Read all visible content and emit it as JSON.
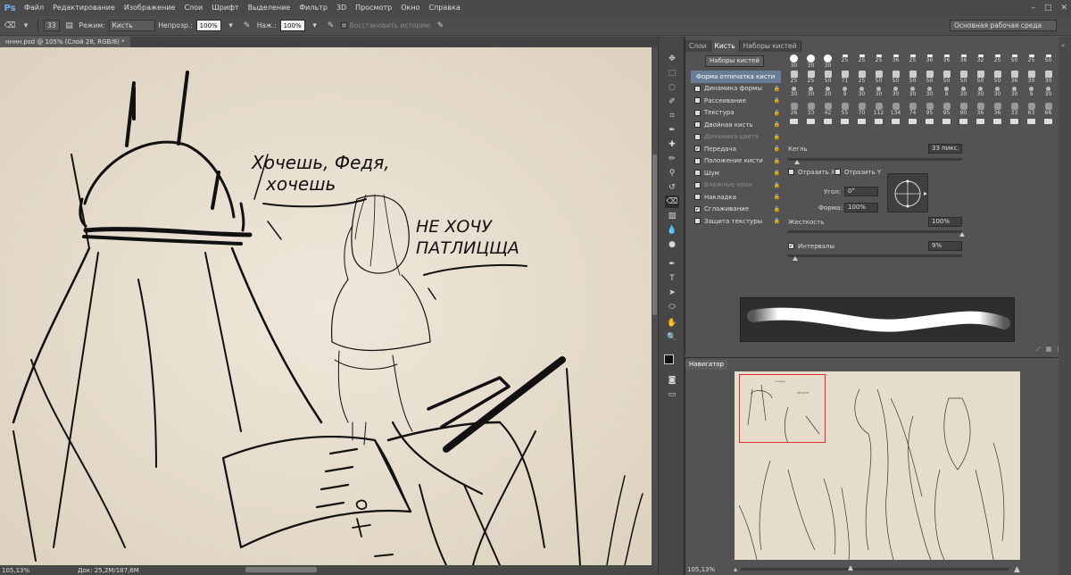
{
  "app": {
    "logo": "Ps"
  },
  "menu": [
    "Файл",
    "Редактирование",
    "Изображение",
    "Слои",
    "Шрифт",
    "Выделение",
    "Фильтр",
    "3D",
    "Просмотр",
    "Окно",
    "Справка"
  ],
  "options": {
    "brush_size": "33",
    "mode_label": "Режим:",
    "mode_value": "Кисть",
    "opacity_label": "Непрозр.:",
    "opacity_value": "100%",
    "pressure_label": "Наж.:",
    "pressure_value": "100%",
    "restore_history": "Восстановить историю",
    "workspace": "Основная рабочая среда"
  },
  "document": {
    "tab": "нннн.psd @ 105% (Слой 28, RGB/8) *",
    "zoom": "105,13%",
    "doc_info": "Док: 25,2M/187,6M"
  },
  "canvas_text": {
    "speech1_line1": "Хочешь, Федя,",
    "speech1_line2": "хочешь",
    "speech2_line1": "НЕ ХОЧУ",
    "speech2_line2": "ПАТЛИЦЩА"
  },
  "brush_panel": {
    "tabs": [
      "Слои",
      "Кисть",
      "Наборы кистей"
    ],
    "active_tab": 1,
    "presets_button": "Наборы кистей",
    "options": [
      {
        "label": "Форма отпечатка кисти",
        "header": true,
        "checked": false,
        "locked": false,
        "disabled": false
      },
      {
        "label": "Динамика формы",
        "header": false,
        "checked": false,
        "locked": true,
        "disabled": false
      },
      {
        "label": "Рассеивание",
        "header": false,
        "checked": false,
        "locked": true,
        "disabled": false
      },
      {
        "label": "Текстура",
        "header": false,
        "checked": false,
        "locked": true,
        "disabled": false
      },
      {
        "label": "Двойная кисть",
        "header": false,
        "checked": false,
        "locked": true,
        "disabled": false
      },
      {
        "label": "Динамика цвета",
        "header": false,
        "checked": false,
        "locked": true,
        "disabled": true
      },
      {
        "label": "Передача",
        "header": false,
        "checked": true,
        "locked": true,
        "disabled": false
      },
      {
        "label": "Положение кисти",
        "header": false,
        "checked": false,
        "locked": true,
        "disabled": false
      },
      {
        "label": "Шум",
        "header": false,
        "checked": false,
        "locked": true,
        "disabled": false
      },
      {
        "label": "Влажные края",
        "header": false,
        "checked": false,
        "locked": true,
        "disabled": true
      },
      {
        "label": "Накладка",
        "header": false,
        "checked": false,
        "locked": true,
        "disabled": false
      },
      {
        "label": "Сглаживание",
        "header": false,
        "checked": true,
        "locked": true,
        "disabled": false
      },
      {
        "label": "Защита текстуры",
        "header": false,
        "checked": false,
        "locked": true,
        "disabled": false
      }
    ],
    "tip_sizes": [
      "30",
      "30",
      "30",
      "25",
      "25",
      "25",
      "36",
      "25",
      "36",
      "36",
      "36",
      "32",
      "25",
      "50",
      "25",
      "50",
      "25",
      "25",
      "50",
      "71",
      "25",
      "50",
      "50",
      "50",
      "50",
      "50",
      "50",
      "50",
      "50",
      "36",
      "30",
      "30",
      "30",
      "30",
      "30",
      "9",
      "30",
      "30",
      "30",
      "30",
      "30",
      "9",
      "30",
      "30",
      "30",
      "30",
      "9",
      "30",
      "26",
      "33",
      "42",
      "55",
      "70",
      "112",
      "134",
      "74",
      "95",
      "95",
      "90",
      "36",
      "36",
      "33",
      "63",
      "66",
      "",
      "",
      "",
      "",
      "",
      "",
      "",
      "",
      "",
      "",
      "",
      "",
      "",
      "",
      "",
      ""
    ],
    "size_label": "Кегль",
    "size_value": "33 пикс.",
    "flip_x": "Отразить X",
    "flip_y": "Отразить Y",
    "angle_label": "Угол:",
    "angle_value": "0°",
    "roundness_label": "Форма:",
    "roundness_value": "100%",
    "hardness_label": "Жесткость",
    "hardness_value": "100%",
    "spacing_label": "Интервалы",
    "spacing_value": "9%",
    "size_fraction": 0.05,
    "hardness_fraction": 1.0,
    "spacing_fraction": 0.04
  },
  "navigator": {
    "tab": "Навигатор",
    "zoom": "105,13%"
  }
}
